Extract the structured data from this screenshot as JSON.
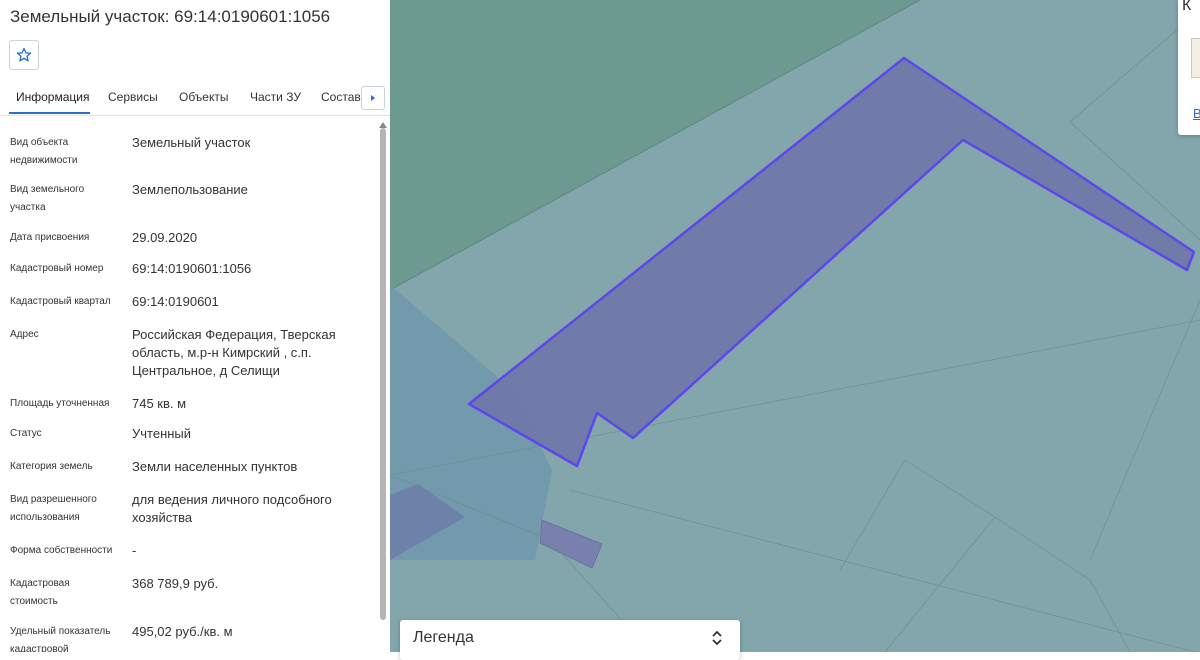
{
  "header": {
    "title": "Земельный участок: 69:14:0190601:1056"
  },
  "tabs": [
    {
      "label": "Информация",
      "active": true
    },
    {
      "label": "Сервисы",
      "active": false
    },
    {
      "label": "Объекты",
      "active": false
    },
    {
      "label": "Части ЗУ",
      "active": false
    },
    {
      "label": "Состав",
      "active": false
    }
  ],
  "icons": {
    "favorite": "star-icon",
    "tabs_next": "chevron-right-icon",
    "legend_toggle": "expand-collapse-icon"
  },
  "info_rows": [
    {
      "label": "Вид объекта недвижимости",
      "value": "Земельный участок"
    },
    {
      "label": "Вид земельного участка",
      "value": "Землепользование"
    },
    {
      "label": "Дата присвоения",
      "value": "29.09.2020"
    },
    {
      "label": "Кадастровый номер",
      "value": "69:14:0190601:1056"
    },
    {
      "label": "Кадастровый квартал",
      "value": "69:14:0190601"
    },
    {
      "label": "Адрес",
      "value": "Российская Федерация, Тверская область, м.р-н Кимрский , с.п. Центральное, д Селищи"
    },
    {
      "label": "Площадь уточненная",
      "value": "745 кв. м"
    },
    {
      "label": "Статус",
      "value": "Учтенный"
    },
    {
      "label": "Категория земель",
      "value": "Земли населенных пунктов"
    },
    {
      "label": "Вид разрешенного использования",
      "value": "для ведения личного подсобного хозяйства"
    },
    {
      "label": "Форма собственности",
      "value": "-"
    },
    {
      "label": "Кадастровая стоимость",
      "value": "368 789,9 руб."
    },
    {
      "label": "Удельный показатель кадастровой",
      "value": "495,02 руб./кв. м"
    }
  ],
  "legend": {
    "label": "Легенда",
    "toggle_glyph": "⌃⌄"
  },
  "corner_card": {
    "letter": "К",
    "link": "В"
  },
  "colors": {
    "accent": "#2a6ec6",
    "parcel_fill": "#6f78aa",
    "parcel_stroke": "#5b3ff0",
    "map_base": "#82a6ab",
    "map_dark": "#6c9a90"
  }
}
